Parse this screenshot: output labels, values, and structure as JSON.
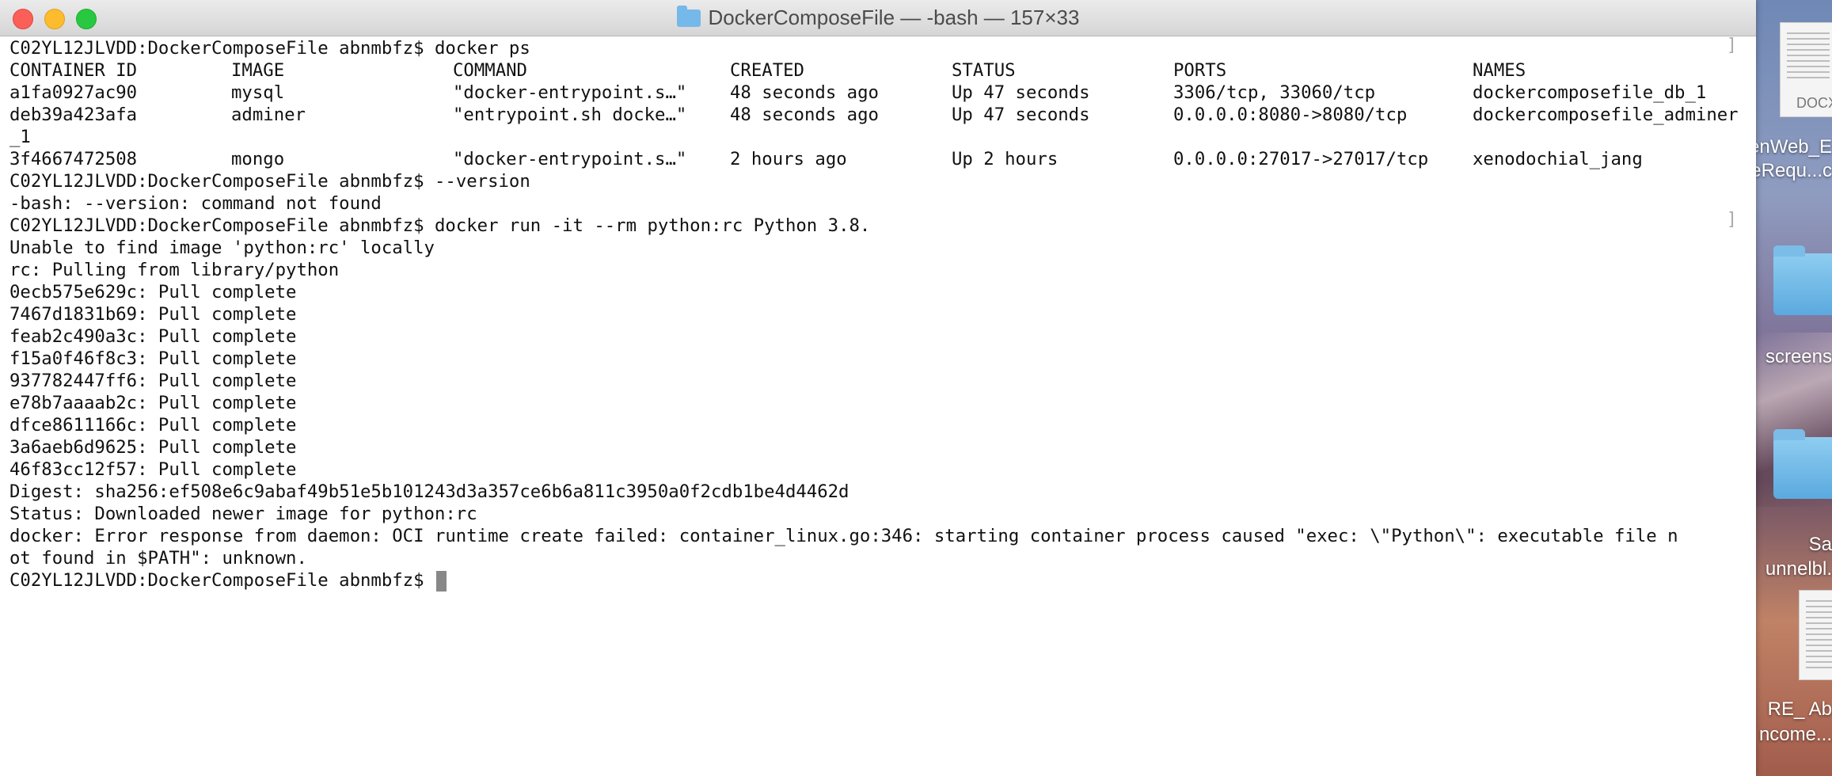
{
  "window": {
    "title": "DockerComposeFile — -bash — 157×33"
  },
  "terminal": {
    "prompt": "C02YL12JLVDD:DockerComposeFile abnmbfz$ ",
    "cmd1": "docker ps",
    "ps_headers": [
      "CONTAINER ID",
      "IMAGE",
      "COMMAND",
      "CREATED",
      "STATUS",
      "PORTS",
      "NAMES"
    ],
    "ps_rows": [
      [
        "a1fa0927ac90",
        "mysql",
        "\"docker-entrypoint.s…\"",
        "48 seconds ago",
        "Up 47 seconds",
        "3306/tcp, 33060/tcp",
        "dockercomposefile_db_1"
      ],
      [
        "deb39a423afa",
        "adminer",
        "\"entrypoint.sh docke…\"",
        "48 seconds ago",
        "Up 47 seconds",
        "0.0.0.0:8080->8080/tcp",
        "dockercomposefile_adminer"
      ],
      [
        "3f4667472508",
        "mongo",
        "\"docker-entrypoint.s…\"",
        "2 hours ago",
        "Up 2 hours",
        "0.0.0.0:27017->27017/tcp",
        "xenodochial_jang"
      ]
    ],
    "wrap_suffix": "_1",
    "cmd2": "--version",
    "out2": "-bash: --version: command not found",
    "cmd3": "docker run -it --rm python:rc Python 3.8.",
    "out3": [
      "Unable to find image 'python:rc' locally",
      "rc: Pulling from library/python",
      "0ecb575e629c: Pull complete",
      "7467d1831b69: Pull complete",
      "feab2c490a3c: Pull complete",
      "f15a0f46f8c3: Pull complete",
      "937782447ff6: Pull complete",
      "e78b7aaaab2c: Pull complete",
      "dfce8611166c: Pull complete",
      "3a6aeb6d9625: Pull complete",
      "46f83cc12f57: Pull complete",
      "Digest: sha256:ef508e6c9abaf49b51e5b101243d3a357ce6b6a811c3950a0f2cdb1be4d4462d",
      "Status: Downloaded newer image for python:rc",
      "docker: Error response from daemon: OCI runtime create failed: container_linux.go:346: starting container process caused \"exec: \\\"Python\\\": executable file n",
      "ot found in $PATH\": unknown."
    ]
  },
  "desktop": {
    "doc_tag": "DOCX",
    "labels": [
      "enWeb_E",
      "eRequ...c",
      "screens",
      "Sa",
      "unnelbl.",
      "RE_ Ab",
      "ncome..."
    ]
  }
}
